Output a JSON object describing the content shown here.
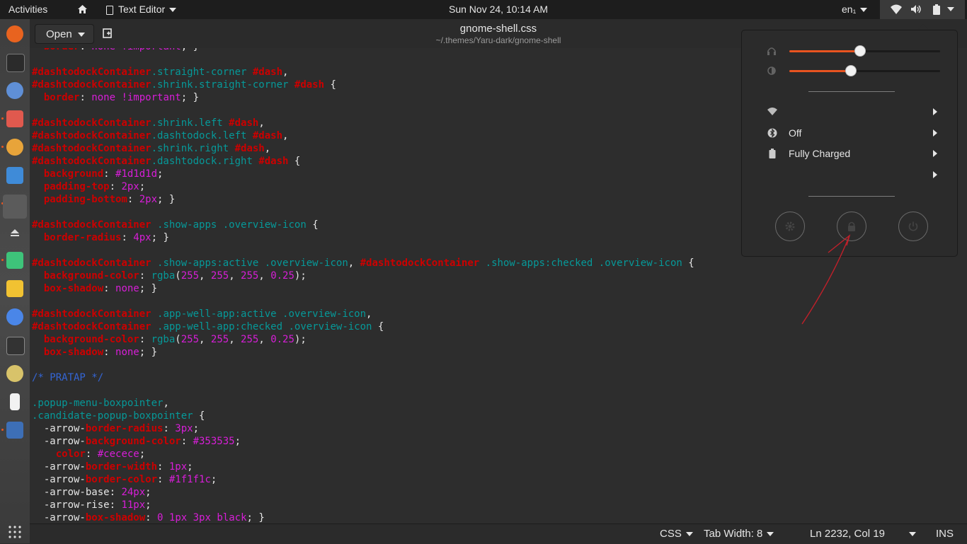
{
  "topbar": {
    "activities": "Activities",
    "app_menu": "Text Editor",
    "clock": "Sun Nov 24, 10:14 AM",
    "keyboard_layout": "en₁"
  },
  "header": {
    "open_label": "Open",
    "title": "gnome-shell.css",
    "subtitle": "~/.themes/Yaru-dark/gnome-shell"
  },
  "editor": {
    "lines": [
      "  border: none !important; }",
      "",
      "#dashtodockContainer.straight-corner #dash,",
      "#dashtodockContainer.shrink.straight-corner #dash {",
      "  border: none !important; }",
      "",
      "#dashtodockContainer.shrink.left #dash,",
      "#dashtodockContainer.dashtodock.left #dash,",
      "#dashtodockContainer.shrink.right #dash,",
      "#dashtodockContainer.dashtodock.right #dash {",
      "  background: #1d1d1d;",
      "  padding-top: 2px;",
      "  padding-bottom: 2px; }",
      "",
      "#dashtodockContainer .show-apps .overview-icon {",
      "  border-radius: 4px; }",
      "",
      "#dashtodockContainer .show-apps:active .overview-icon, #dashtodockContainer .show-apps:checked .overview-icon {",
      "  background-color: rgba(255, 255, 255, 0.25);",
      "  box-shadow: none; }",
      "",
      "#dashtodockContainer .app-well-app:active .overview-icon,",
      "#dashtodockContainer .app-well-app:checked .overview-icon {",
      "  background-color: rgba(255, 255, 255, 0.25);",
      "  box-shadow: none; }",
      "",
      "/* PRATAP */",
      "",
      ".popup-menu-boxpointer,",
      ".candidate-popup-boxpointer {",
      "  -arrow-border-radius: 3px;",
      "  -arrow-background-color: #353535;",
      "    color: #cecece;",
      "  -arrow-border-width: 1px;",
      "  -arrow-border-color: #1f1f1c;",
      "  -arrow-base: 24px;",
      "  -arrow-rise: 11px;",
      "  -arrow-box-shadow: 0 1px 3px black; }"
    ]
  },
  "statusbar": {
    "language": "CSS",
    "tab_width": "Tab Width: 8",
    "position": "Ln 2232, Col 19",
    "mode": "INS"
  },
  "system_menu": {
    "volume_level": 0.47,
    "brightness_level": 0.41,
    "wifi_label": "",
    "bluetooth_label": "Off",
    "battery_label": "Fully Charged",
    "user_label": ""
  },
  "colors": {
    "accent": "#e95420",
    "selector": "#cc0000",
    "class": "#069999",
    "value": "#d81ed8",
    "comment": "#3465d4"
  }
}
